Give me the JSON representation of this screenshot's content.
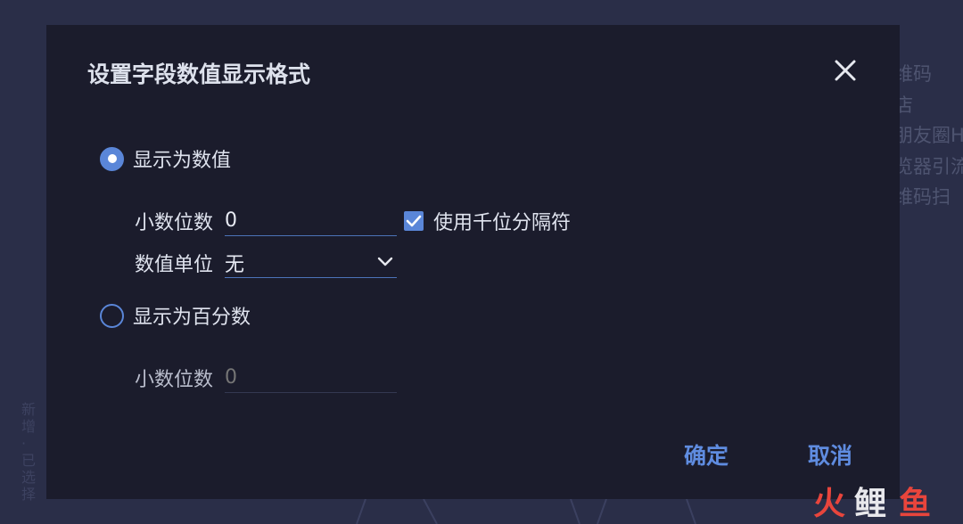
{
  "background": {
    "list_items": [
      "维码",
      "店",
      "朋友圈H",
      "览器引流",
      "维码扫"
    ],
    "vertical_text": "新增·已选择"
  },
  "dialog": {
    "title": "设置字段数值显示格式",
    "close_icon": "close-icon",
    "options": {
      "as_number": {
        "label": "显示为数值",
        "checked": true,
        "decimals_label": "小数位数",
        "decimals_value": "0",
        "thousands_separator_label": "使用千位分隔符",
        "thousands_separator_checked": true,
        "unit_label": "数值单位",
        "unit_value": "无"
      },
      "as_percent": {
        "label": "显示为百分数",
        "checked": false,
        "decimals_label": "小数位数",
        "decimals_placeholder": "0"
      }
    },
    "confirm_label": "确定",
    "cancel_label": "取消"
  },
  "watermark": {
    "text": "火鲤鱼",
    "colors": {
      "fire": "#e8453c",
      "carp": "#e8e8ec"
    }
  },
  "colors": {
    "accent": "#5a86d8",
    "dialog_bg": "#1b1c2c",
    "page_bg": "#2a2e48"
  }
}
